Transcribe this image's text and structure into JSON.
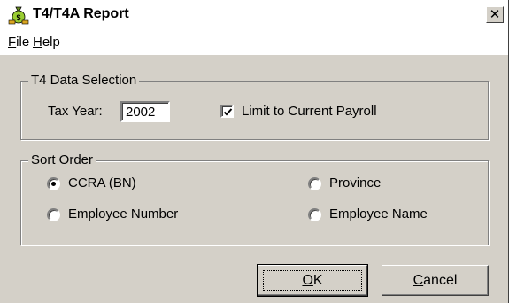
{
  "window": {
    "title": "T4/T4A Report",
    "close_glyph": "✕"
  },
  "menu": {
    "file": {
      "mnemonic": "F",
      "rest": "ile"
    },
    "help": {
      "mnemonic": "H",
      "rest": "elp"
    }
  },
  "data_selection": {
    "group_label": "T4 Data Selection",
    "tax_year_label": "Tax Year:",
    "tax_year_value": "2002",
    "limit_label": "Limit to Current Payroll",
    "limit_checked": true
  },
  "sort_order": {
    "group_label": "Sort Order",
    "options": [
      {
        "label": "CCRA (BN)",
        "selected": true
      },
      {
        "label": "Province",
        "selected": false
      },
      {
        "label": "Employee Number",
        "selected": false
      },
      {
        "label": "Employee Name",
        "selected": false
      }
    ]
  },
  "buttons": {
    "ok": {
      "mnemonic": "O",
      "rest": "K"
    },
    "cancel": {
      "mnemonic": "C",
      "rest": "ancel"
    }
  },
  "icons": {
    "app": "money-bag-icon",
    "close": "close-icon",
    "check": "checkmark-icon"
  }
}
